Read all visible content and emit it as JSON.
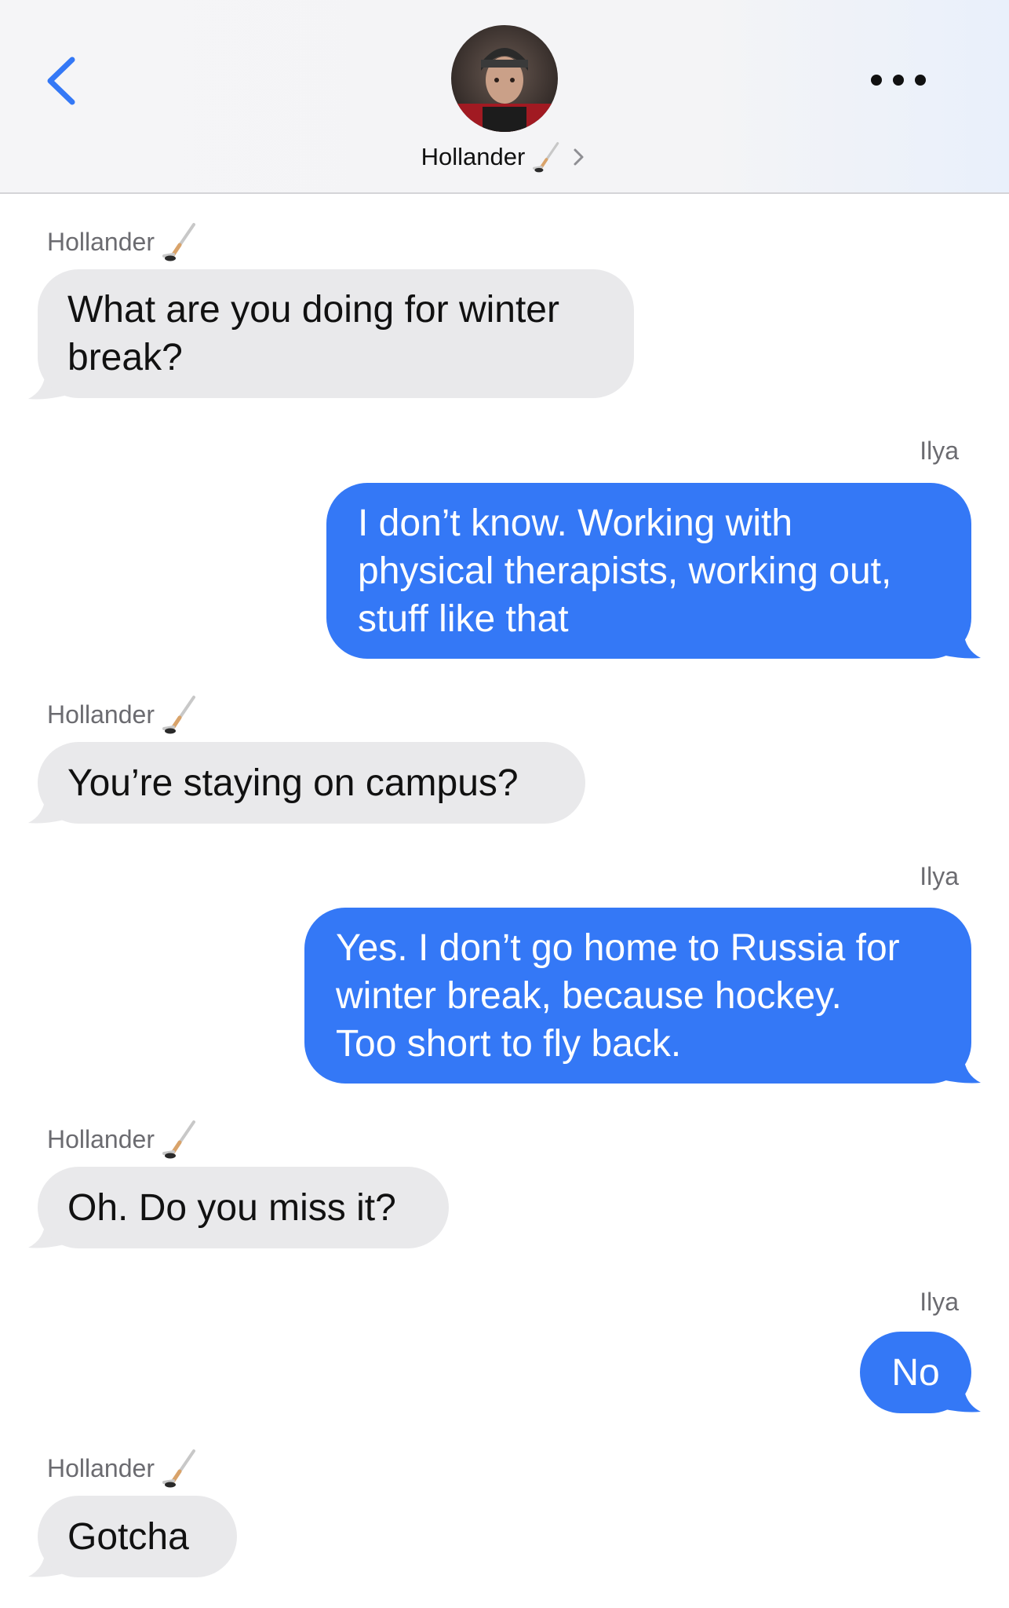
{
  "header": {
    "contact_name": "Hollander",
    "back_icon": "chevron-left-icon",
    "more_icon": "ellipsis-icon",
    "accent": "#3478f6"
  },
  "messages": [
    {
      "sender": "Hollander",
      "direction": "incoming",
      "text": "What are you doing for winter\nbreak?"
    },
    {
      "sender": "Ilya",
      "direction": "outgoing",
      "text": "I don’t know. Working with\nphysical therapists, working out,\nstuff like that"
    },
    {
      "sender": "Hollander",
      "direction": "incoming",
      "text": "You’re staying on campus?"
    },
    {
      "sender": "Ilya",
      "direction": "outgoing",
      "text": "Yes. I don’t go home to Russia for\nwinter break, because hockey.\nToo short to fly back."
    },
    {
      "sender": "Hollander",
      "direction": "incoming",
      "text": "Oh. Do you miss it?"
    },
    {
      "sender": "Ilya",
      "direction": "outgoing",
      "text": "No"
    },
    {
      "sender": "Hollander",
      "direction": "incoming",
      "text": "Gotcha"
    }
  ],
  "colors": {
    "incoming_bubble": "#e9e9eb",
    "outgoing_bubble": "#3478f6",
    "sender_label": "#6b6b70"
  }
}
